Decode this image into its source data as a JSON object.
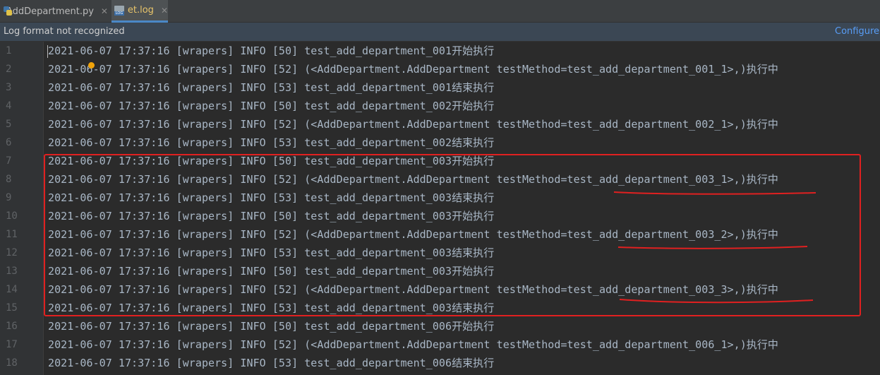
{
  "tabs": [
    {
      "label": "AddDepartment.py",
      "icon": "python-file-icon",
      "active": false
    },
    {
      "label": "et.log",
      "icon": "log-file-icon",
      "active": true
    }
  ],
  "notification": {
    "message": "Log format not recognized",
    "action": "Configure l"
  },
  "lines": [
    {
      "n": "1",
      "text": "2021-06-07 17:37:16 [wrapers] INFO [50] test_add_department_001开始执行"
    },
    {
      "n": "2",
      "text": "2021-06-07 17:37:16 [wrapers] INFO [52] (<AddDepartment.AddDepartment testMethod=test_add_department_001_1>,)执行中"
    },
    {
      "n": "3",
      "text": "2021-06-07 17:37:16 [wrapers] INFO [53] test_add_department_001结束执行"
    },
    {
      "n": "4",
      "text": "2021-06-07 17:37:16 [wrapers] INFO [50] test_add_department_002开始执行"
    },
    {
      "n": "5",
      "text": "2021-06-07 17:37:16 [wrapers] INFO [52] (<AddDepartment.AddDepartment testMethod=test_add_department_002_1>,)执行中"
    },
    {
      "n": "6",
      "text": "2021-06-07 17:37:16 [wrapers] INFO [53] test_add_department_002结束执行"
    },
    {
      "n": "7",
      "text": "2021-06-07 17:37:16 [wrapers] INFO [50] test_add_department_003开始执行"
    },
    {
      "n": "8",
      "text": "2021-06-07 17:37:16 [wrapers] INFO [52] (<AddDepartment.AddDepartment testMethod=test_add_department_003_1>,)执行中"
    },
    {
      "n": "9",
      "text": "2021-06-07 17:37:16 [wrapers] INFO [53] test_add_department_003结束执行"
    },
    {
      "n": "10",
      "text": "2021-06-07 17:37:16 [wrapers] INFO [50] test_add_department_003开始执行"
    },
    {
      "n": "11",
      "text": "2021-06-07 17:37:16 [wrapers] INFO [52] (<AddDepartment.AddDepartment testMethod=test_add_department_003_2>,)执行中"
    },
    {
      "n": "12",
      "text": "2021-06-07 17:37:16 [wrapers] INFO [53] test_add_department_003结束执行"
    },
    {
      "n": "13",
      "text": "2021-06-07 17:37:16 [wrapers] INFO [50] test_add_department_003开始执行"
    },
    {
      "n": "14",
      "text": "2021-06-07 17:37:16 [wrapers] INFO [52] (<AddDepartment.AddDepartment testMethod=test_add_department_003_3>,)执行中"
    },
    {
      "n": "15",
      "text": "2021-06-07 17:37:16 [wrapers] INFO [53] test_add_department_003结束执行"
    },
    {
      "n": "16",
      "text": "2021-06-07 17:37:16 [wrapers] INFO [50] test_add_department_006开始执行"
    },
    {
      "n": "17",
      "text": "2021-06-07 17:37:16 [wrapers] INFO [52] (<AddDepartment.AddDepartment testMethod=test_add_department_006_1>,)执行中"
    },
    {
      "n": "18",
      "text": "2021-06-07 17:37:16 [wrapers] INFO [53] test_add_department_006结束执行"
    }
  ],
  "colors": {
    "editor_bg": "#2b2b2b",
    "text": "#a9b7c6",
    "line_number": "#606366",
    "highlight_annotation": "#e02020",
    "link": "#589df6"
  }
}
